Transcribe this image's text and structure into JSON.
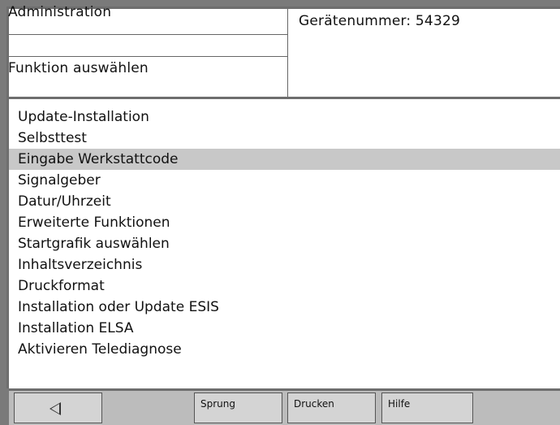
{
  "header": {
    "title": "Administration",
    "device_number": "Gerätenummer: 54329",
    "function_label": "Funktion auswählen"
  },
  "menu": {
    "selected_index": 2,
    "items": [
      {
        "label": "Update-Installation"
      },
      {
        "label": "Selbsttest"
      },
      {
        "label": "Eingabe Werkstattcode"
      },
      {
        "label": "Signalgeber"
      },
      {
        "label": "Datur/Uhrzeit"
      },
      {
        "label": "Erweiterte Funktionen"
      },
      {
        "label": "Startgrafik auswählen"
      },
      {
        "label": "Inhaltsverzeichnis"
      },
      {
        "label": "Druckformat"
      },
      {
        "label": "Installation oder Update ESIS"
      },
      {
        "label": "Installation ELSA"
      },
      {
        "label": "Aktivieren Telediagnose"
      }
    ]
  },
  "toolbar": {
    "back_icon": "triangle-left-icon",
    "sprung_label": "Sprung",
    "drucken_label": "Drucken",
    "hilfe_label": "Hilfe"
  },
  "colors": {
    "frame": "#6e6e6e",
    "selected_row": "#c8c8c8",
    "toolbar": "#bcbcbc",
    "button": "#d4d4d4"
  }
}
